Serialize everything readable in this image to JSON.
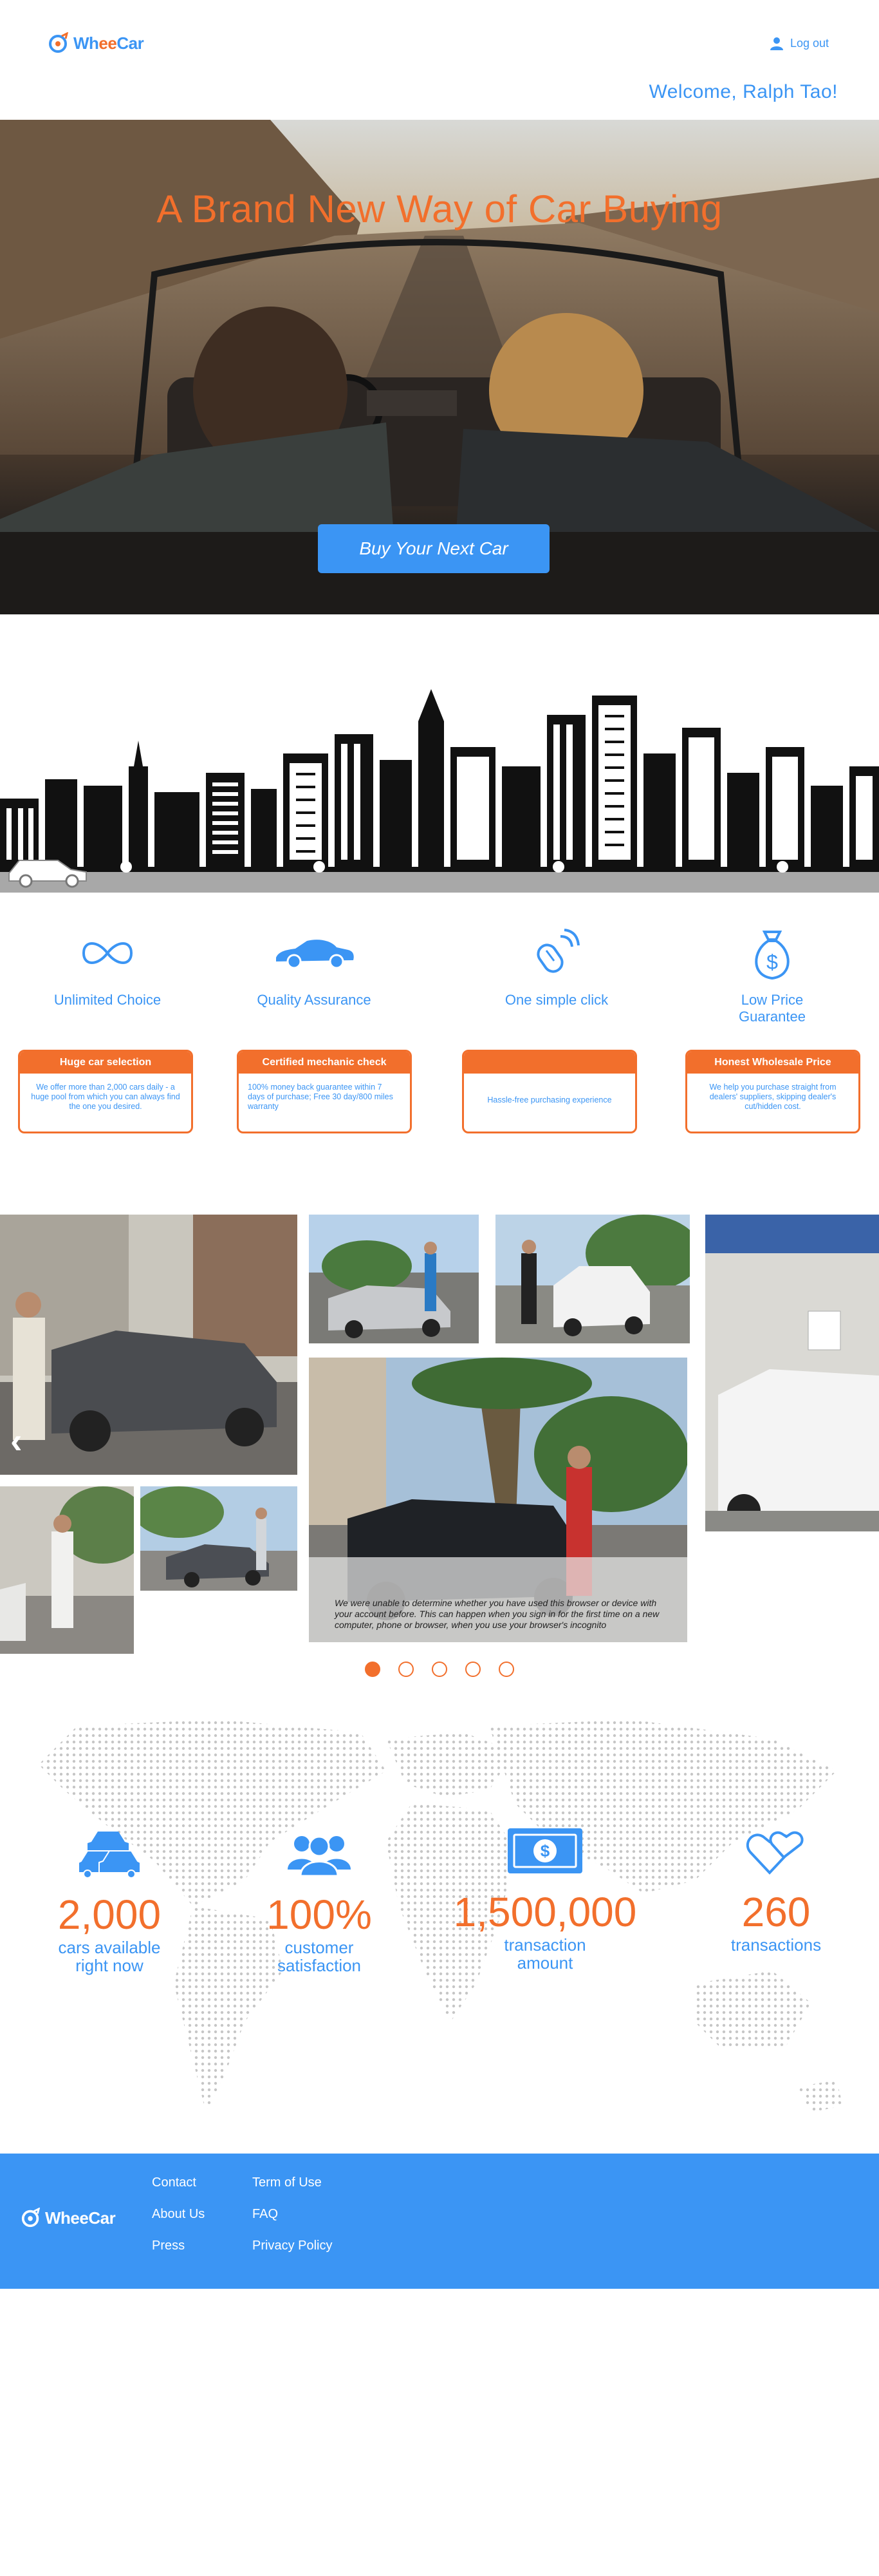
{
  "header": {
    "logo_text_1": "Wh",
    "logo_text_2": "ee",
    "logo_text_3": "Car",
    "logout_label": "Log out",
    "welcome_text": "Welcome, Ralph Tao!"
  },
  "hero": {
    "title": "A Brand New Way of Car Buying",
    "button_label": "Buy Your Next Car"
  },
  "features": [
    {
      "icon": "infinity-icon",
      "title": "Unlimited Choice",
      "card_title": "Huge car selection",
      "card_body": "We offer more than 2,000 cars daily - a huge pool from which you can always find the one you desired."
    },
    {
      "icon": "car-icon",
      "title": "Quality Assurance",
      "card_title": "Certified mechanic check",
      "card_body": "100% money back guarantee within 7 days of purchase; Free 30 day/800 miles warranty"
    },
    {
      "icon": "mouse-click-icon",
      "title": "One simple click",
      "card_title": "",
      "card_body": "Hassle-free purchasing experience"
    },
    {
      "icon": "money-bag-icon",
      "title": "Low Price Guarantee",
      "card_title": "Honest Wholesale Price",
      "card_body": "We help you purchase straight from dealers' suppliers, skipping dealer's cut/hidden cost."
    }
  ],
  "gallery": {
    "caption": "We were unable to determine whether you have used this browser or device with your account before. This can happen when you sign in for the first time on a new computer, phone or browser, when you use your browser's incognito",
    "prev_arrow": "‹",
    "active_dot": 0,
    "dot_count": 5
  },
  "stats": [
    {
      "icon": "cars-icon",
      "value": "2,000",
      "label": "cars available right now"
    },
    {
      "icon": "people-icon",
      "value": "100%",
      "label": "customer satisfaction"
    },
    {
      "icon": "dollar-bill-icon",
      "value": "1,500,000",
      "label": "transaction amount"
    },
    {
      "icon": "hearts-icon",
      "value": "260",
      "label": "transactions"
    }
  ],
  "footer": {
    "col1": [
      "Contact",
      "About Us",
      "Press"
    ],
    "col2": [
      "Term of Use",
      "FAQ",
      "Privacy Policy"
    ]
  },
  "colors": {
    "brand_blue": "#3b95f4",
    "brand_orange": "#f26f2c"
  }
}
